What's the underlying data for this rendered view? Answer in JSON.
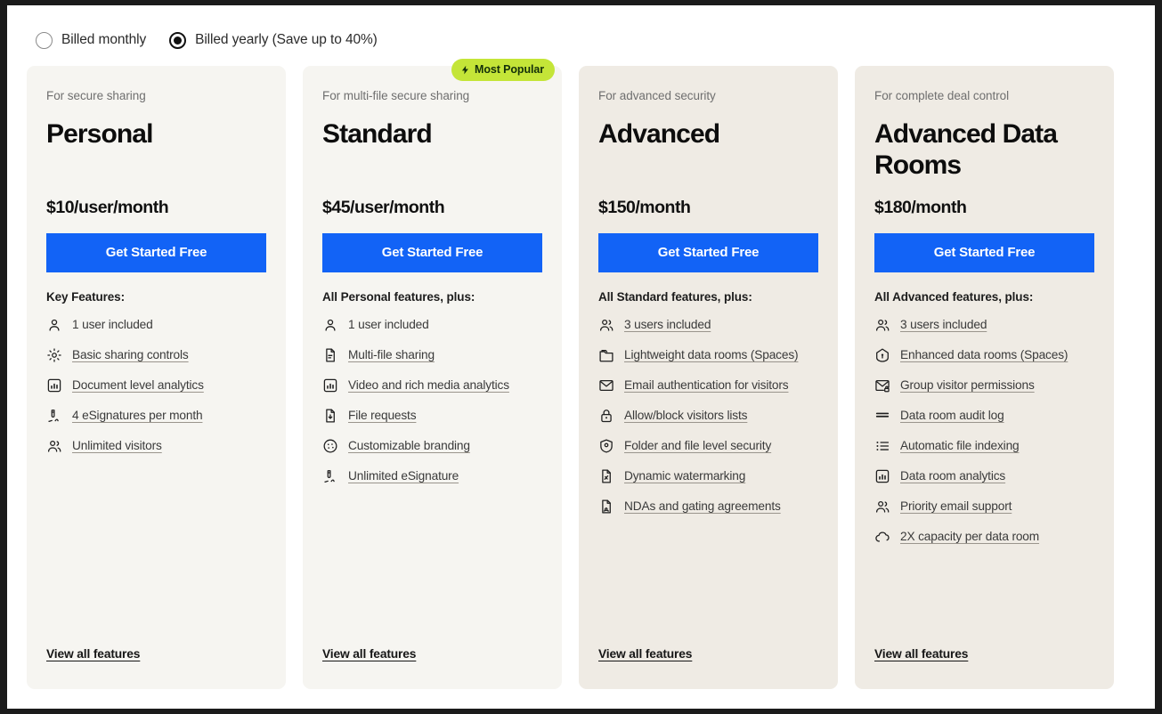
{
  "billing": {
    "options": [
      {
        "label": "Billed monthly",
        "selected": false
      },
      {
        "label": "Billed yearly (Save up to 40%)",
        "selected": true
      }
    ]
  },
  "badge": {
    "label": "Most Popular",
    "color": "#c4e538",
    "icon": "bolt-icon"
  },
  "cta_label": "Get Started Free",
  "view_all_label": "View all features",
  "accent_color": "#1263f6",
  "plans": [
    {
      "tagline": "For secure sharing",
      "name": "Personal",
      "price": "$10/user/month",
      "features_heading": "Key Features:",
      "badge": false,
      "tone": "light",
      "features": [
        {
          "icon": "user-icon",
          "label": "1 user included",
          "underline": false
        },
        {
          "icon": "gear-icon",
          "label": "Basic sharing controls",
          "underline": true
        },
        {
          "icon": "chart-icon",
          "label": "Document level analytics",
          "underline": true
        },
        {
          "icon": "signature-icon",
          "label": "4 eSignatures per month",
          "underline": true
        },
        {
          "icon": "users-icon",
          "label": "Unlimited visitors",
          "underline": true
        }
      ]
    },
    {
      "tagline": "For multi-file secure sharing",
      "name": "Standard",
      "price": "$45/user/month",
      "features_heading": "All Personal features, plus:",
      "badge": true,
      "tone": "light",
      "features": [
        {
          "icon": "user-icon",
          "label": "1 user included",
          "underline": false
        },
        {
          "icon": "document-icon",
          "label": "Multi-file sharing",
          "underline": true
        },
        {
          "icon": "chart-icon",
          "label": "Video and rich media analytics",
          "underline": true
        },
        {
          "icon": "file-download-icon",
          "label": "File requests",
          "underline": true
        },
        {
          "icon": "palette-icon",
          "label": "Customizable branding",
          "underline": true
        },
        {
          "icon": "signature-icon",
          "label": "Unlimited eSignature",
          "underline": true
        }
      ]
    },
    {
      "tagline": "For advanced security",
      "name": "Advanced",
      "price": "$150/month",
      "features_heading": "All Standard features, plus:",
      "badge": false,
      "tone": "warm",
      "features": [
        {
          "icon": "users-icon",
          "label": "3 users included",
          "underline": true
        },
        {
          "icon": "folder-icon",
          "label": "Lightweight data rooms (Spaces)",
          "underline": true
        },
        {
          "icon": "envelope-icon",
          "label": "Email authentication for visitors",
          "underline": true
        },
        {
          "icon": "lock-icon",
          "label": "Allow/block visitors lists",
          "underline": true
        },
        {
          "icon": "shield-pin-icon",
          "label": "Folder and file level security",
          "underline": true
        },
        {
          "icon": "watermark-doc-icon",
          "label": "Dynamic watermarking",
          "underline": true
        },
        {
          "icon": "nda-doc-icon",
          "label": "NDAs and gating agreements",
          "underline": true
        }
      ]
    },
    {
      "tagline": "For complete deal control",
      "name": "Advanced Data Rooms",
      "price": "$180/month",
      "features_heading": "All Advanced features, plus:",
      "badge": false,
      "tone": "warm",
      "features": [
        {
          "icon": "users-icon",
          "label": "3 users included",
          "underline": true
        },
        {
          "icon": "home-shield-icon",
          "label": "Enhanced data rooms (Spaces)",
          "underline": true
        },
        {
          "icon": "envelope-lock-icon",
          "label": "Group visitor permissions",
          "underline": true
        },
        {
          "icon": "audit-lines-icon",
          "label": "Data room audit log",
          "underline": true
        },
        {
          "icon": "list-index-icon",
          "label": "Automatic file indexing",
          "underline": true
        },
        {
          "icon": "chart-icon",
          "label": "Data room analytics",
          "underline": true
        },
        {
          "icon": "users-icon",
          "label": "Priority email support",
          "underline": true
        },
        {
          "icon": "cloud-icon",
          "label": "2X capacity per data room",
          "underline": true
        }
      ]
    }
  ]
}
